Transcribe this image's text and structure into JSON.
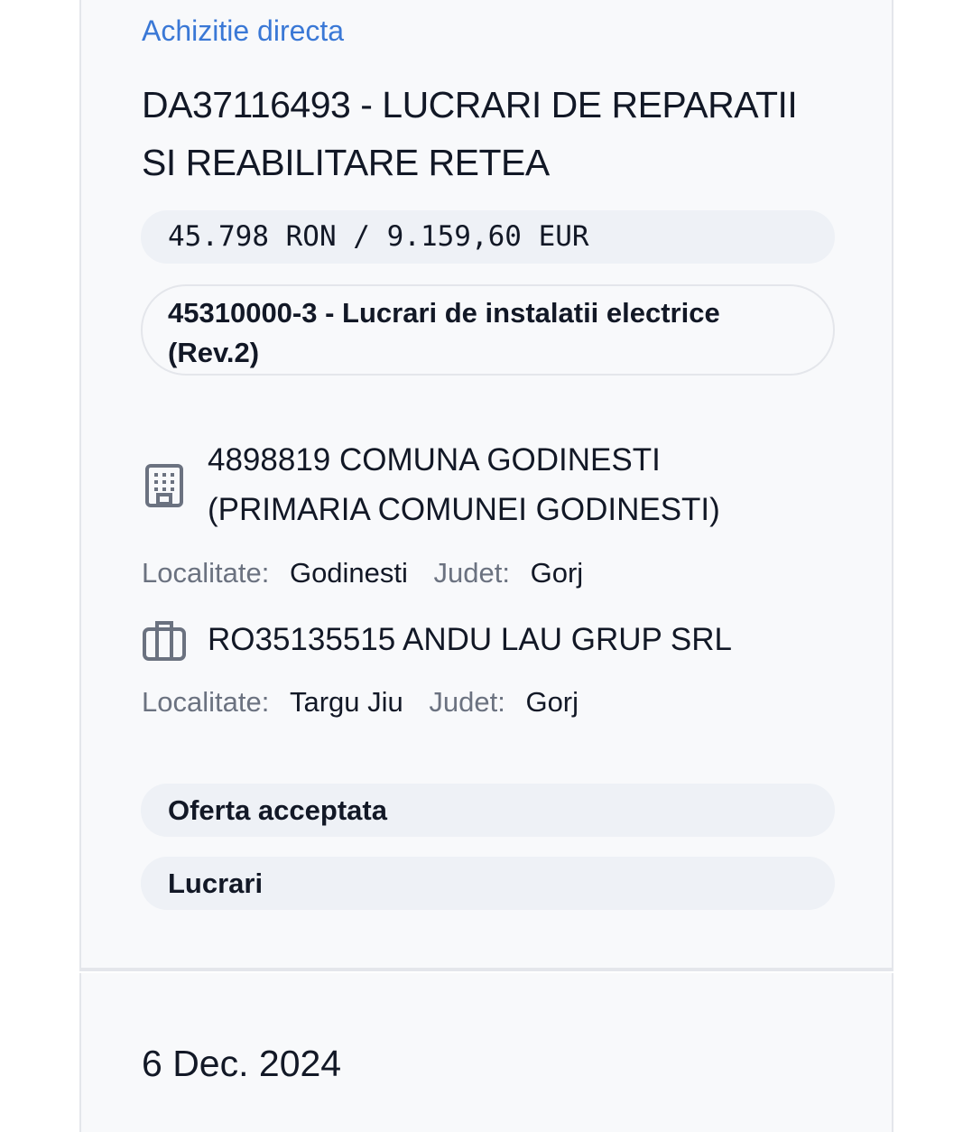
{
  "procedure": {
    "type_label": "Achizitie directa",
    "title": "DA37116493 - LUCRARI DE REPARATII SI REABILITARE RETEA",
    "value": "45.798 RON / 9.159,60 EUR",
    "cpv": "45310000-3 - Lucrari de instalatii electrice (Rev.2)"
  },
  "authority": {
    "icon": "building-icon",
    "name": "4898819 COMUNA GODINESTI (PRIMARIA COMUNEI GODINESTI)",
    "locality_label": "Localitate:",
    "locality": "Godinesti",
    "county_label": "Judet:",
    "county": "Gorj"
  },
  "supplier": {
    "icon": "briefcase-icon",
    "name": "RO35135515 ANDU LAU GRUP SRL",
    "locality_label": "Localitate:",
    "locality": "Targu Jiu",
    "county_label": "Judet:",
    "county": "Gorj"
  },
  "status": "Oferta acceptata",
  "category": "Lucrari",
  "date": "6 Dec. 2024",
  "colors": {
    "accent": "#3a78d6",
    "text": "#121826",
    "muted": "#6b7280",
    "pill_bg": "#eef1f6",
    "card_bg": "#f8f9fb"
  }
}
